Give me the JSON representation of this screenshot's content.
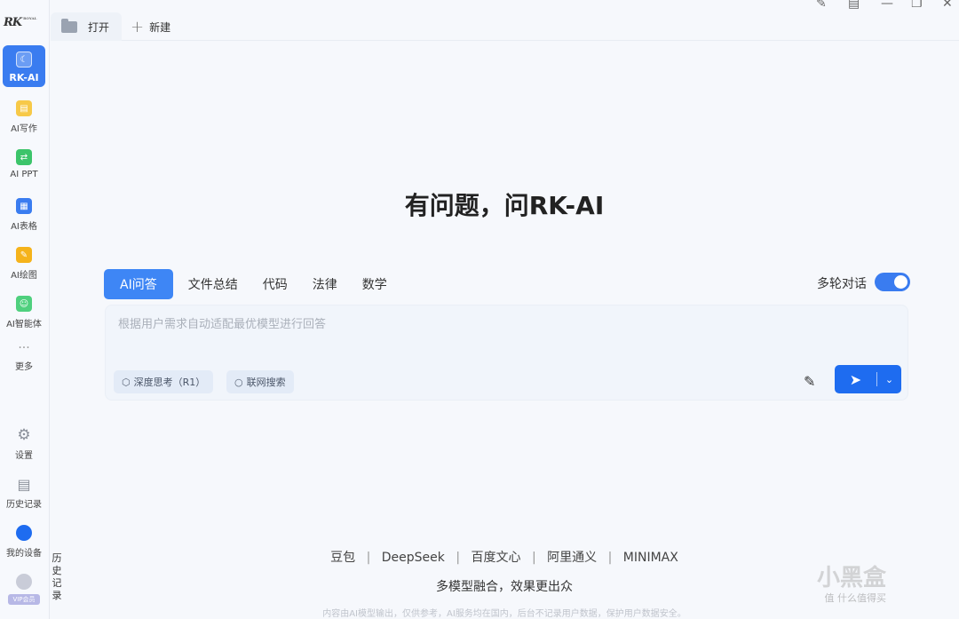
{
  "sidebar": {
    "logo_text": "RK",
    "logo_sub": "ROYAL",
    "items": [
      {
        "label": "RK-AI",
        "icon": "chat-icon"
      },
      {
        "label": "AI写作",
        "icon": "write-icon"
      },
      {
        "label": "AI PPT",
        "icon": "ppt-icon"
      },
      {
        "label": "AI表格",
        "icon": "table-icon"
      },
      {
        "label": "AI绘图",
        "icon": "paint-icon"
      },
      {
        "label": "AI智能体",
        "icon": "robot-icon"
      },
      {
        "label": "更多",
        "icon": "more-icon"
      }
    ],
    "bottom": [
      {
        "label": "设置",
        "icon": "gear-icon"
      },
      {
        "label": "历史记录",
        "icon": "history-icon"
      },
      {
        "label": "我的设备",
        "icon": "device-icon"
      }
    ],
    "vip_label": "VIP会员"
  },
  "tabs": {
    "open_label": "打开",
    "new_label": "新建"
  },
  "main": {
    "headline": "有问题，问RK-AI",
    "modes": [
      "AI问答",
      "文件总结",
      "代码",
      "法律",
      "数学"
    ],
    "active_mode": "AI问答",
    "multi_turn_label": "多轮对话",
    "multi_turn_on": true,
    "input_placeholder": "根据用户需求自动适配最优模型进行回答",
    "chip_deep": "深度思考（R1）",
    "chip_search": "联网搜索"
  },
  "footer": {
    "models": [
      "豆包",
      "DeepSeek",
      "百度文心",
      "阿里通义",
      "MINIMAX"
    ],
    "separator": "|",
    "slogan": "多模型融合，效果更出众",
    "disclaimer": "内容由AI模型输出，仅供参考，AI服务均在国内，后台不记录用户数据，保护用户数据安全。",
    "history_vertical": [
      "历",
      "史",
      "记",
      "录"
    ]
  },
  "watermark": {
    "text": "小黑盒",
    "sub": "值 什么值得买"
  },
  "colors": {
    "accent": "#3a7cf0",
    "send": "#1e6cf0"
  }
}
